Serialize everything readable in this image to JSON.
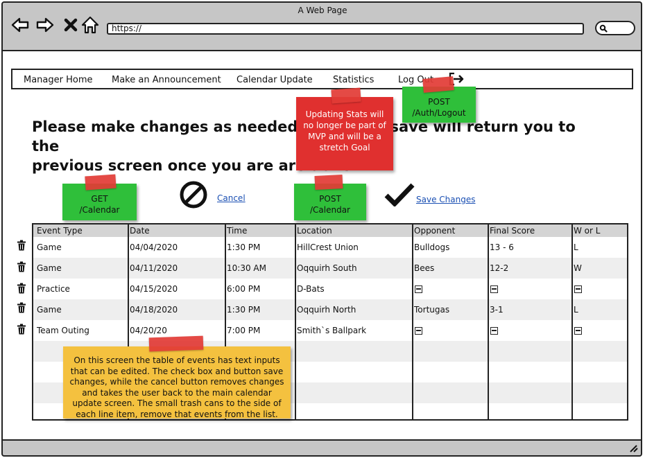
{
  "window": {
    "title": "A Web Page"
  },
  "browser": {
    "url": "https://"
  },
  "nav": {
    "items": [
      "Manager Home",
      "Make an Announcement",
      "Calendar Update",
      "Statistics",
      "Log Out"
    ]
  },
  "page": {
    "title_line1": "Please make changes as needed. Cancel or save will return you to the",
    "title_line2": "previous screen once you are are done."
  },
  "notes": {
    "get_calendar": {
      "line1": "GET",
      "line2": "/Calendar"
    },
    "post_calendar": {
      "line1": "POST",
      "line2": "/Calendar"
    },
    "post_logout": {
      "line1": "POST",
      "line2": "/Auth/Logout"
    },
    "stats_note": "Updating Stats will no longer be part of MVP and will be a stretch Goal",
    "info_note": "On this screen the table of events has text inputs that can be edited. The check box and button save changes, while the cancel button removes changes and takes the user back to the main calendar update screen. The small trash cans to the side of each line item, remove that events from the list."
  },
  "actions": {
    "cancel_label": "Cancel",
    "save_label": "Save Changes"
  },
  "table": {
    "headers": [
      "Event Type",
      "Date",
      "Time",
      "Location",
      "Opponent",
      "Final Score",
      "W or L"
    ],
    "rows": [
      {
        "event_type": "Game",
        "date": "04/04/2020",
        "time": "1:30 PM",
        "location": "HillCrest Union",
        "opponent": "Bulldogs",
        "score": "13 - 6",
        "result": "L"
      },
      {
        "event_type": "Game",
        "date": "04/11/2020",
        "time": "10:30 AM",
        "location": "Oqquirh South",
        "opponent": "Bees",
        "score": "12-2",
        "result": "W"
      },
      {
        "event_type": "Practice",
        "date": "04/15/2020",
        "time": "6:00 PM",
        "location": "D-Bats",
        "opponent": "",
        "score": "",
        "result": ""
      },
      {
        "event_type": "Game",
        "date": "04/18/2020",
        "time": "1:30 PM",
        "location": "Oqquirh North",
        "opponent": "Tortugas",
        "score": "3-1",
        "result": "L"
      },
      {
        "event_type": "Team Outing",
        "date": "04/20/20",
        "time": "7:00 PM",
        "location": "Smith`s Ballpark",
        "opponent": "",
        "score": "",
        "result": ""
      }
    ]
  },
  "icons": {
    "back": "arrow-left-icon",
    "forward": "arrow-right-icon",
    "close": "close-icon",
    "home": "home-icon",
    "search": "search-icon",
    "logout": "logout-icon",
    "cancel": "no-entry-icon",
    "save": "checkmark-icon",
    "trash": "trash-icon",
    "empty": "empty-box-icon"
  },
  "colors": {
    "chrome": "#c6c6c6",
    "note_green": "#2fbf3a",
    "note_red": "#e0302f",
    "note_yellow": "#f4c13f",
    "link": "#1a4fb3",
    "header_row": "#d4d4d4",
    "alt_row": "#eeeeee"
  }
}
